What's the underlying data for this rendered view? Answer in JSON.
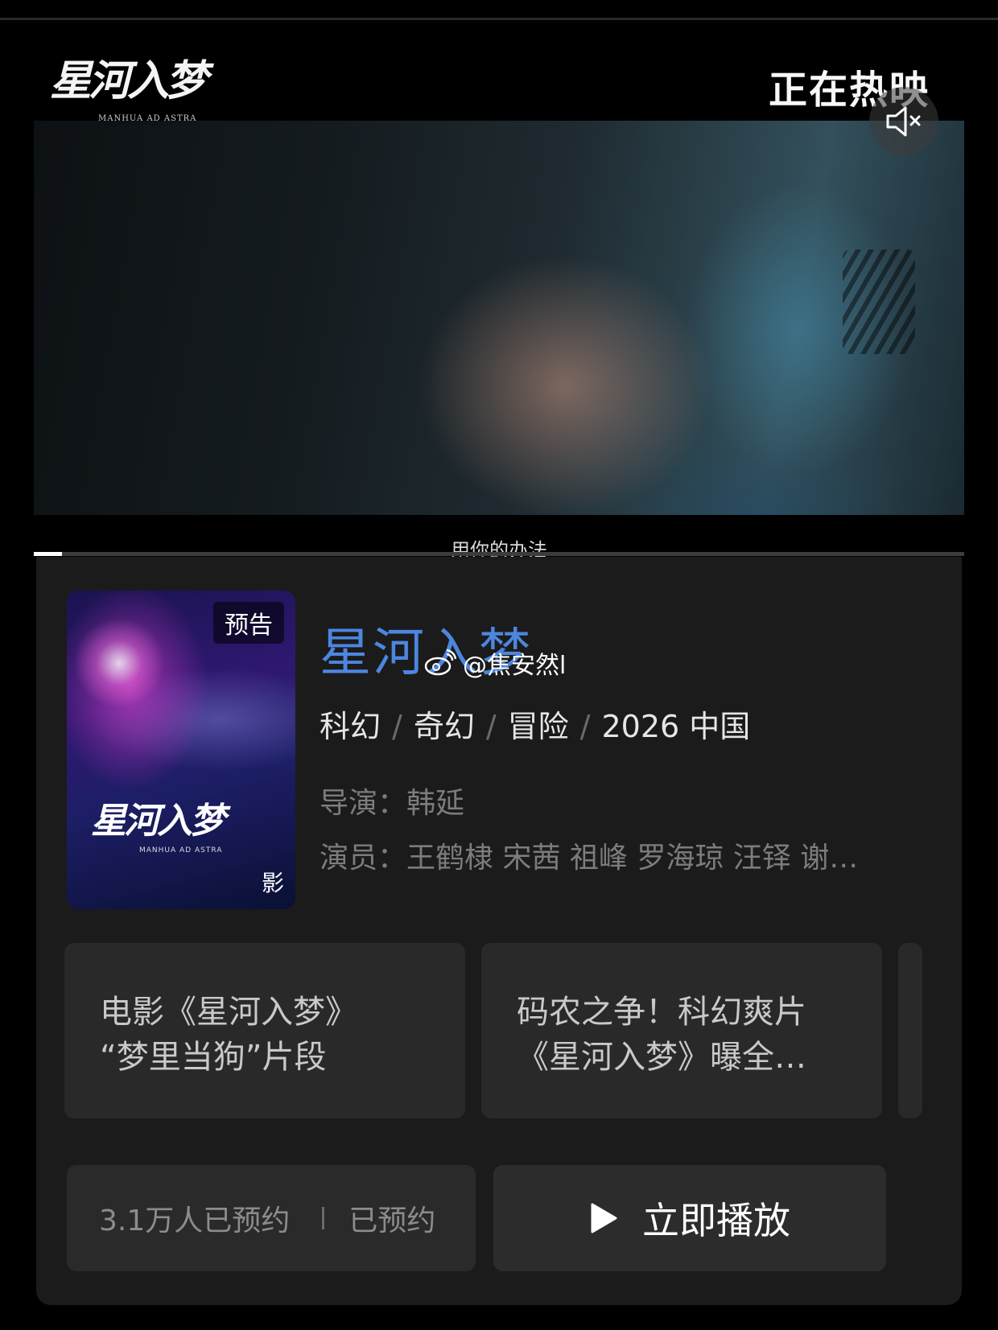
{
  "video": {
    "logo_text": "星河入梦",
    "logo_subtext": "MANHUA AD ASTRA",
    "status_text": "正在热映",
    "subtitle": "用你的办法",
    "progress_fraction": 0.03,
    "mute_icon": "mute-icon"
  },
  "movie": {
    "poster_tag": "预告",
    "poster_title": "星河入梦",
    "poster_subtitle": "MANHUA AD ASTRA",
    "poster_corner": "影",
    "title": "星河入梦",
    "watermark": "@焦安然l",
    "genres": [
      "科幻",
      "奇幻",
      "冒险"
    ],
    "year_region": "2026 中国",
    "director_label": "导演：",
    "director": "韩延",
    "cast_label": "演员：",
    "cast": "王鹤棣 宋茜 祖峰 罗海琼 汪铎 谢…"
  },
  "clips": [
    {
      "line1": "电影《星河入梦》",
      "line2": "“梦里当狗”片段"
    },
    {
      "line1": "码农之争！科幻爽片",
      "line2": "《星河入梦》曝全…"
    }
  ],
  "actions": {
    "reserve_count": "3.1万人已预约",
    "reserved_label": "已预约",
    "play_label": "立即播放"
  },
  "colors": {
    "title_blue": "#4c86df",
    "card_bg": "#1b1b1b",
    "button_bg": "#2a2a2a"
  }
}
